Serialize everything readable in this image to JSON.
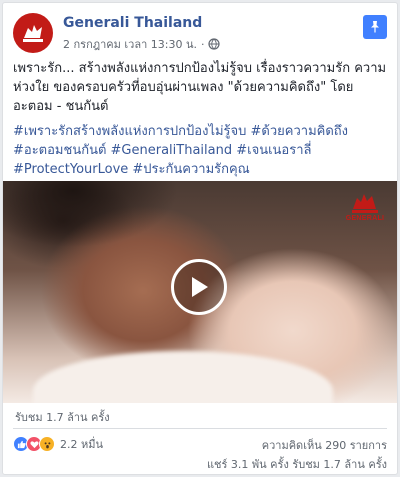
{
  "post": {
    "page_name": "Generali Thailand",
    "timestamp": "2 กรกฎาคม เวลา 13:30 น.",
    "caption_lines": [
      "เพราะรัก... สร้างพลังแห่งการปกป้องไม่รู้จบ เรื่องราวความรัก ความห่วงใย ของครอบครัวที่อบอุ่นผ่านเพลง \"ด้วยความคิดถึง\" โดย อะตอม - ชนกันต์"
    ],
    "hashtags": "#เพราะรักสร้างพลังแห่งการปกป้องไม่รู้จบ #ด้วยความคิดถึง #อะตอมชนกันต์ #GeneraliThailand #เจนเนอราลี่ #ProtectYourLove #ประกันความรักคุณ"
  },
  "video": {
    "brand_text": "GENERALI"
  },
  "stats": {
    "views": "รับชม 1.7 ล้าน ครั้ง",
    "reaction_count": "2.2 หมื่น",
    "comments": "ความคิดเห็น 290 รายการ",
    "shares_views": "แชร์ 3.1 พัน ครั้ง  รับชม 1.7 ล้าน ครั้ง"
  },
  "icons": {
    "avatar": "generali-lion-logo-icon",
    "globe": "globe-icon",
    "pin": "pin-icon",
    "play": "play-icon",
    "reactions": [
      "like-icon",
      "love-icon",
      "wow-icon"
    ]
  },
  "colors": {
    "brand": "#c21b17",
    "link": "#385898",
    "pin_bg": "#4080ff"
  }
}
